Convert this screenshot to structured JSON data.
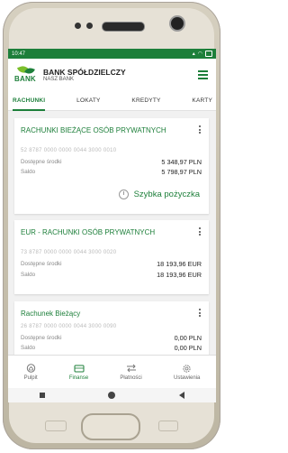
{
  "status_bar": {
    "time": "10:47",
    "indicators": "... ◈ ▾ 🔋"
  },
  "header": {
    "logo_text": "BANK",
    "bank_name": "BANK SPÓŁDZIELCZY",
    "bank_subname": "NASZ BANK"
  },
  "tabs": [
    {
      "label": "RACHUNKI",
      "active": true
    },
    {
      "label": "LOKATY",
      "active": false
    },
    {
      "label": "KREDYTY",
      "active": false
    },
    {
      "label": "KARTY",
      "active": false
    }
  ],
  "accounts": [
    {
      "title": "RACHUNKI BIEŻĄCE OSÓB PRYWATNYCH",
      "account_number": "52 8787 0000 0000 0044 3000 0010",
      "available_label": "Dostępne środki",
      "available_value": "5 348,97 PLN",
      "balance_label": "Saldo",
      "balance_value": "5 798,97 PLN",
      "action_label": "Szybka pożyczka"
    },
    {
      "title": "EUR - RACHUNKI OSÓB PRYWATNYCH",
      "account_number": "73 8787 0000 0000 0044 3000 0020",
      "available_label": "Dostępne środki",
      "available_value": "18 193,96 EUR",
      "balance_label": "Saldo",
      "balance_value": "18 193,96 EUR"
    },
    {
      "title": "Rachunek Bieżący",
      "account_number": "26 8787 0000 0000 0044 3000 0090",
      "available_label": "Dostępne środki",
      "available_value": "0,00 PLN",
      "balance_label": "Saldo",
      "balance_value": "0,00 PLN"
    }
  ],
  "bottom_nav": [
    {
      "label": "Pulpit",
      "icon": "home-icon",
      "active": false
    },
    {
      "label": "Finanse",
      "icon": "wallet-icon",
      "active": true
    },
    {
      "label": "Płatności",
      "icon": "transfer-icon",
      "active": false
    },
    {
      "label": "Ustawienia",
      "icon": "gear-icon",
      "active": false
    }
  ],
  "colors": {
    "brand_green": "#1d7f3a",
    "leaf_light": "#7bbf2b"
  }
}
